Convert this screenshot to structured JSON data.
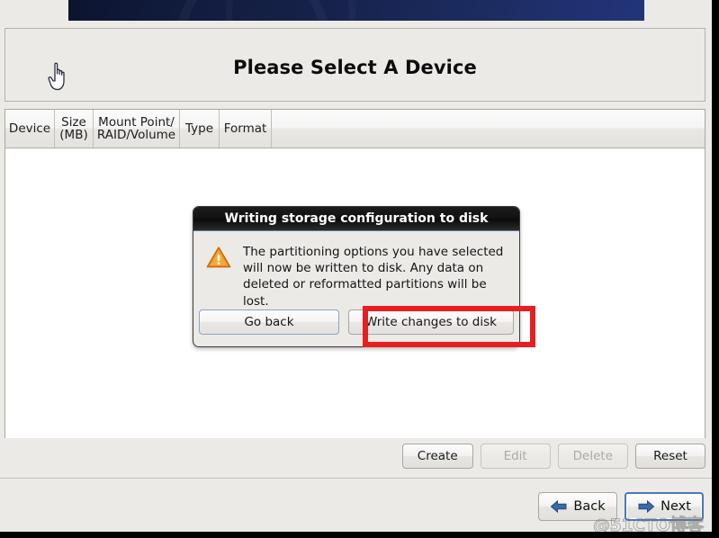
{
  "window": {
    "background_color": "#eceae7",
    "banner_color": "#16224b"
  },
  "title_panel": {
    "title": "Please Select A Device",
    "cursor_icon": "hand-pointer-cursor"
  },
  "table": {
    "columns": [
      {
        "label": "Device"
      },
      {
        "label": "Size\n(MB)"
      },
      {
        "label": "Mount Point/\nRAID/Volume"
      },
      {
        "label": "Type"
      },
      {
        "label": "Format"
      }
    ],
    "rows": []
  },
  "action_buttons": [
    {
      "label": "Create",
      "name": "create-button",
      "disabled": false
    },
    {
      "label": "Edit",
      "name": "edit-button",
      "disabled": true
    },
    {
      "label": "Delete",
      "name": "delete-button",
      "disabled": true
    },
    {
      "label": "Reset",
      "name": "reset-button",
      "disabled": false
    }
  ],
  "nav_buttons": {
    "back": {
      "label": "Back",
      "icon": "arrow-left-icon",
      "focused": false
    },
    "next": {
      "label": "Next",
      "icon": "arrow-right-icon",
      "focused": true
    }
  },
  "dialog": {
    "title": "Writing storage configuration to disk",
    "icon": "warning-triangle-icon",
    "message": "The partitioning options you have selected\nwill now be written to disk.  Any data on\ndeleted or reformatted partitions will be lost.",
    "buttons": {
      "go_back": "Go back",
      "write_changes": "Write changes to disk"
    }
  },
  "annotation": {
    "color": "#e62020",
    "target": "write-changes-to-disk-button"
  },
  "watermark": {
    "text": "@51CTO博客"
  }
}
